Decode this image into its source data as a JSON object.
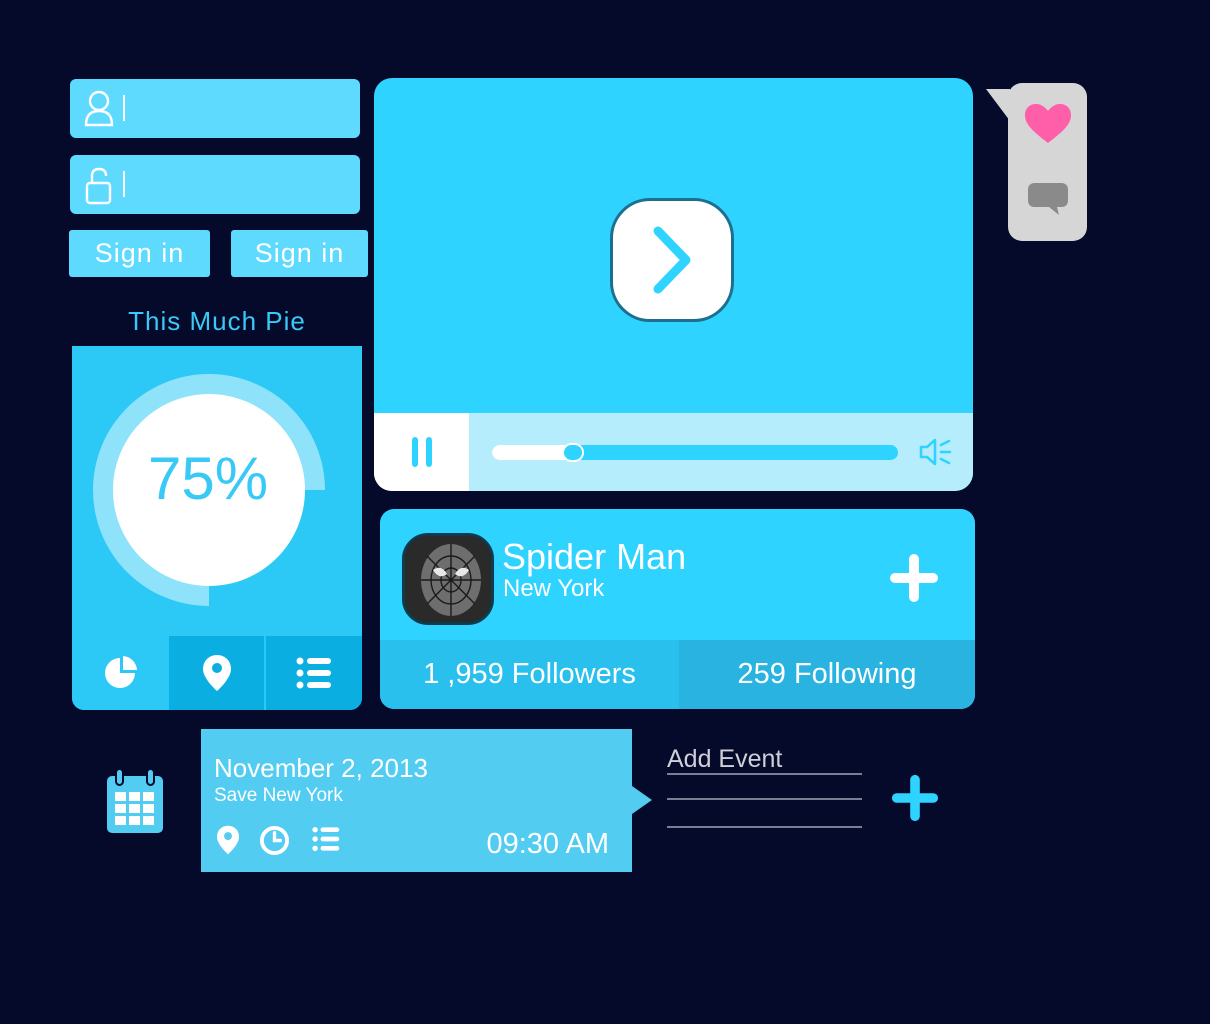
{
  "colors": {
    "background": "#05092a",
    "accent": "#2fd3ff",
    "field": "#5ddafe",
    "heart": "#ff5fa8",
    "comment": "#8a8a8a"
  },
  "login": {
    "username_icon": "user-icon",
    "password_icon": "unlock-icon",
    "buttons": [
      {
        "label": "Sign in"
      },
      {
        "label": "Sign in"
      }
    ]
  },
  "pie": {
    "title": "This Much Pie",
    "percent_label": "75%",
    "percent_value": 0.75,
    "tabs": [
      {
        "icon": "pie-chart-icon",
        "active": false
      },
      {
        "icon": "location-pin-icon",
        "active": true
      },
      {
        "icon": "list-icon",
        "active": false
      }
    ]
  },
  "video": {
    "play_icon": "chevron-right-icon",
    "pause_icon": "pause-icon",
    "volume_icon": "volume-icon",
    "progress": 0.2
  },
  "bubble": {
    "heart_icon": "heart-icon",
    "comment_icon": "comment-icon"
  },
  "profile": {
    "name": "Spider Man",
    "location": "New York",
    "followers": "1 ,959 Followers",
    "following": "259 Following",
    "add_icon": "plus-icon"
  },
  "event": {
    "date": "November 2, 2013",
    "subtitle": "Save New York",
    "time": "09:30 AM",
    "icons": [
      "location-pin-icon",
      "clock-icon",
      "list-icon"
    ],
    "add_placeholder": "Add Event"
  }
}
